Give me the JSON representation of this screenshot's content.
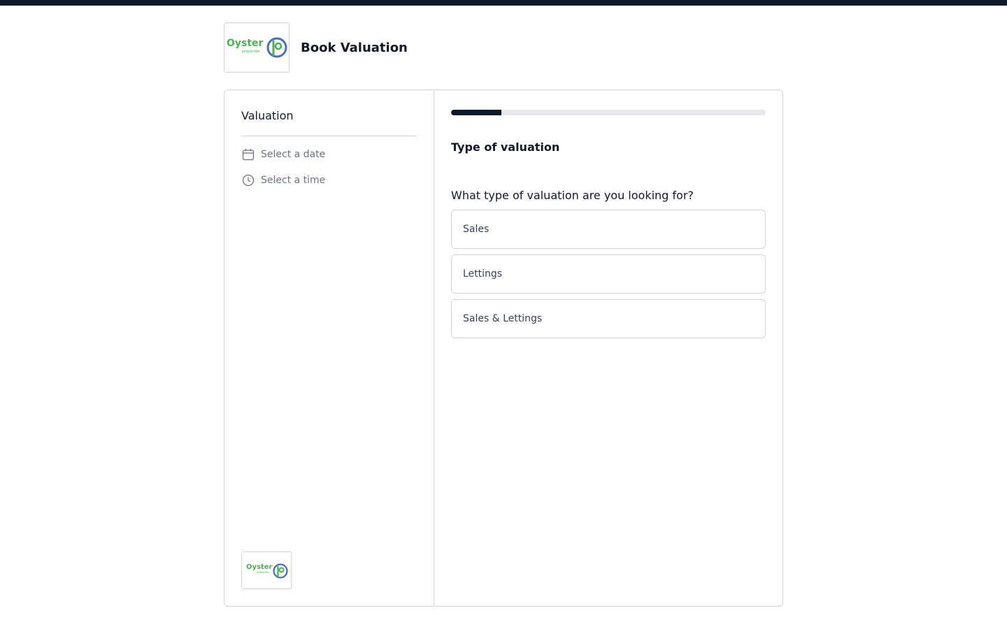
{
  "colors": {
    "accent": "#0f172a",
    "border": "#d1d5db",
    "progress_track": "#e5e7eb",
    "brand_green": "#4caf50",
    "brand_blue": "#4a6fb5"
  },
  "header": {
    "logo_text": "Oyster",
    "logo_subtext": "properties",
    "title": "Book Valuation"
  },
  "sidebar": {
    "title": "Valuation",
    "steps": [
      {
        "label": "Select a date",
        "icon": "calendar-icon"
      },
      {
        "label": "Select a time",
        "icon": "clock-icon"
      }
    ],
    "footer_logo_text": "Oyster",
    "footer_logo_subtext": "properties"
  },
  "main": {
    "progress_fraction": 0.16,
    "section_title": "Type of valuation",
    "question": "What type of valuation are you looking for?",
    "options": [
      "Sales",
      "Lettings",
      "Sales & Lettings"
    ]
  }
}
